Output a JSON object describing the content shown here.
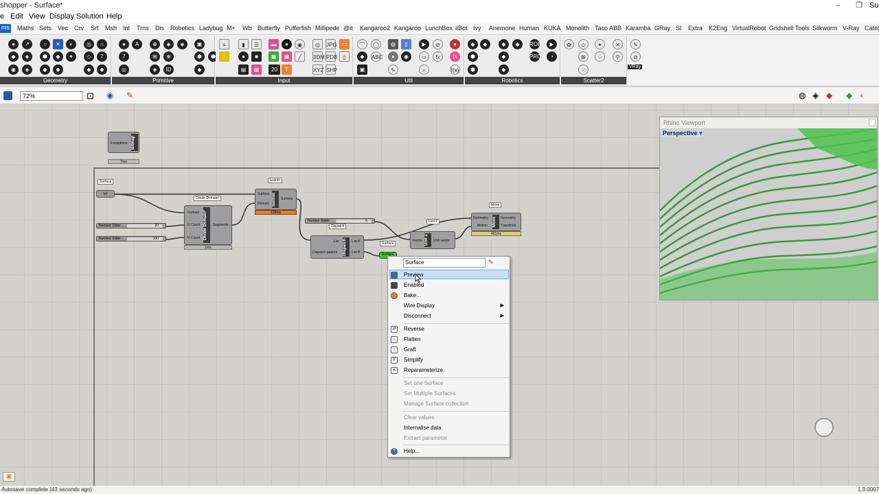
{
  "window": {
    "title": "shopper - Surface*",
    "title_right": "Surf"
  },
  "menu": [
    "e",
    "Edit",
    "View",
    "Display",
    "Solution",
    "Help"
  ],
  "tabs": [
    "ms",
    "Maths",
    "Sets",
    "Vec",
    "Crv",
    "Srf",
    "Msh",
    "Int",
    "Trns",
    "Dis",
    "Robotics",
    "Ladybug",
    "M+",
    "Wb",
    "Butterfly",
    "Pufferfish",
    "Millipede",
    "@it",
    "Kangaroo2",
    "Kangaroo",
    "LunchBox",
    "iiBot",
    "Ivy",
    "Anemone",
    "Human",
    "KUKA",
    "Monolith",
    "Taco ABB",
    "Karamba",
    "GRay",
    "SI",
    "Extra",
    "K2Eng",
    "VirtualRobot",
    "Gridshell Tools",
    "Silkworm",
    "V-Ray",
    "Categ"
  ],
  "panels": [
    "Geometry",
    "Primitive",
    "Input",
    "Util",
    "Robotics",
    "Scatter2"
  ],
  "panel_badges": {
    "num20": "20",
    "vray": "VRay"
  },
  "zoom": "72%",
  "canvas": {
    "bitmap": {
      "label": "Exceptions",
      "core": "Bitmap",
      "time": "7ms"
    },
    "surface_param": {
      "tag": "Surface",
      "port": "Srf"
    },
    "divide_domain": {
      "tag": "Divide Domain²",
      "core": "Divide Domain²",
      "in1": "Domain",
      "in2": "U Count",
      "in3": "V Count",
      "out": "Segments",
      "time": "1ms"
    },
    "slider1": {
      "label": "Number Slider",
      "value": "20"
    },
    "slider2": {
      "label": "Number Slider",
      "value": "100"
    },
    "isotrim": {
      "tag": "Isotrim",
      "core": "Isotrim",
      "in1": "Surface",
      "in2": "Domain",
      "out": "Surface",
      "time": "109ms"
    },
    "slider3": {
      "label": "Number Slider",
      "value": "6"
    },
    "dispatch": {
      "core": "Dispatch",
      "in1": "List",
      "in2": "Dispatch pattern",
      "out1": "List A",
      "out2": "List B",
      "tag": "Dispatch"
    },
    "unitz": {
      "core": "Unit Z",
      "in": "Factor",
      "out": "Unit vector",
      "tag": "Unit Z"
    },
    "move": {
      "tag": "Move",
      "core": "Move",
      "in1": "Geometry",
      "in2": "Motion",
      "out1": "Geometry",
      "out2": "Transform",
      "time": "431ms"
    },
    "surface_out": {
      "tag": "Surface",
      "port": "Surface"
    }
  },
  "viewport": {
    "title": "Rhino Viewport",
    "view": "Perspective"
  },
  "context_menu": {
    "input_value": "Surface",
    "items": [
      {
        "label": "Preview",
        "enabled": true
      },
      {
        "label": "Enabled",
        "enabled": true
      },
      {
        "label": "Bake...",
        "enabled": true
      },
      {
        "label": "Wire Display",
        "enabled": true
      },
      {
        "label": "Disconnect",
        "enabled": true
      },
      {
        "label": "Reverse",
        "enabled": true
      },
      {
        "label": "Flatten",
        "enabled": true
      },
      {
        "label": "Graft",
        "enabled": true
      },
      {
        "label": "Simplify",
        "enabled": true
      },
      {
        "label": "Reparameterize",
        "enabled": true
      },
      {
        "label": "Set one Surface",
        "enabled": false
      },
      {
        "label": "Set Multiple Surfaces",
        "enabled": false
      },
      {
        "label": "Manage Surface collection",
        "enabled": false
      },
      {
        "label": "Clear values",
        "enabled": false
      },
      {
        "label": "Internalise data",
        "enabled": true
      },
      {
        "label": "Extract parameter",
        "enabled": false
      },
      {
        "label": "Help...",
        "enabled": true
      }
    ]
  },
  "status": {
    "left": "Autosave complete (43 seconds ago)",
    "right": "1.0.0007"
  },
  "colors": {
    "accent": "#2060c0",
    "preview_green": "#3cc33c",
    "menu_highlight": "#c9dff8"
  }
}
